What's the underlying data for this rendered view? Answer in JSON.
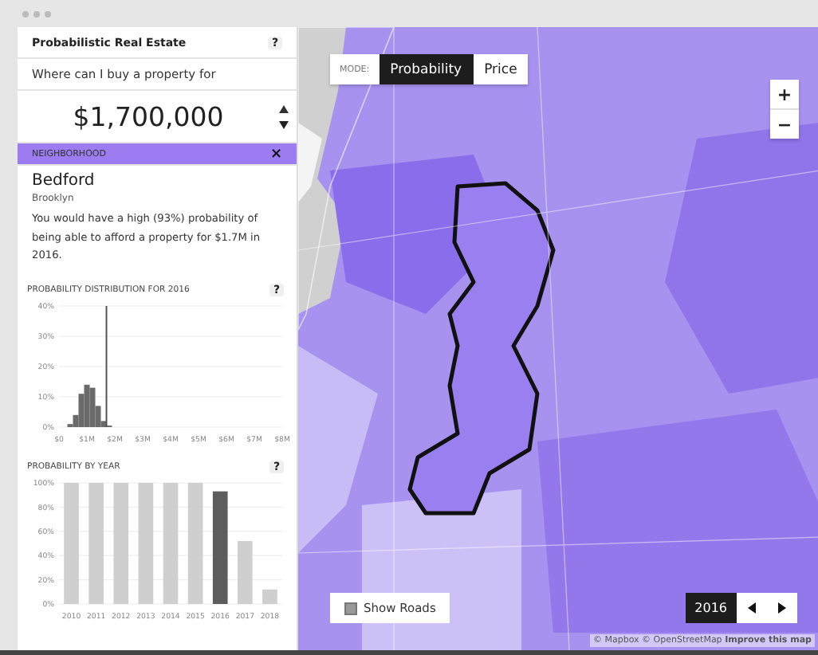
{
  "panel": {
    "title": "Probabilistic Real Estate",
    "help": "?",
    "prompt": "Where can I buy a property for",
    "price": "$1,700,000"
  },
  "neighborhood": {
    "header": "NEIGHBORHOOD",
    "close": "×",
    "name": "Bedford",
    "borough": "Brooklyn",
    "summary": "You would have a high (93%) probability of being able to afford a property for $1.7M in 2016."
  },
  "charts": [
    {
      "title": "PROBABILITY DISTRIBUTION FOR 2016",
      "help": "?",
      "chart_data": {
        "type": "bar",
        "x": [
          0.4,
          0.6,
          0.8,
          1.0,
          1.2,
          1.4,
          1.6,
          1.8
        ],
        "values": [
          1,
          4,
          11,
          14,
          13,
          7,
          2,
          0.5
        ],
        "grid": true,
        "xlim": [
          0,
          8
        ],
        "ylim": [
          0,
          40
        ],
        "xticks": [
          {
            "value": 0,
            "label": "$0"
          },
          {
            "value": 1,
            "label": "$1M"
          },
          {
            "value": 2,
            "label": "$2M"
          },
          {
            "value": 3,
            "label": "$3M"
          },
          {
            "value": 4,
            "label": "$4M"
          },
          {
            "value": 5,
            "label": "$5M"
          },
          {
            "value": 6,
            "label": "$6M"
          },
          {
            "value": 7,
            "label": "$7M"
          },
          {
            "value": 8,
            "label": "$8M"
          }
        ],
        "yticks": [
          {
            "value": 0,
            "label": "0%"
          },
          {
            "value": 10,
            "label": "10%"
          },
          {
            "value": 20,
            "label": "20%"
          },
          {
            "value": 30,
            "label": "30%"
          },
          {
            "value": 40,
            "label": "40%"
          }
        ],
        "ref_lines": [
          {
            "axis": "x",
            "value": 1.7
          }
        ]
      }
    },
    {
      "title": "PROBABILITY BY YEAR",
      "help": "?",
      "chart_data": {
        "type": "bar",
        "categories": [
          "2010",
          "2011",
          "2012",
          "2013",
          "2014",
          "2015",
          "2016",
          "2017",
          "2018"
        ],
        "grid": true,
        "series": [
          {
            "color": "#cfcfcf",
            "values": [
              100,
              100,
              100,
              100,
              100,
              100,
              null,
              52,
              12
            ]
          },
          {
            "color": "#5d5d5d",
            "values": [
              null,
              null,
              null,
              null,
              null,
              null,
              93,
              null,
              null
            ]
          }
        ],
        "ylim": [
          0,
          100
        ],
        "yticks": [
          {
            "value": 0,
            "label": "0%"
          },
          {
            "value": 20,
            "label": "20%"
          },
          {
            "value": 40,
            "label": "40%"
          },
          {
            "value": 60,
            "label": "60%"
          },
          {
            "value": 80,
            "label": "80%"
          },
          {
            "value": 100,
            "label": "100%"
          }
        ]
      }
    }
  ],
  "map": {
    "mode_label": "MODE:",
    "modes": [
      {
        "label": "Probability",
        "selected": true
      },
      {
        "label": "Price",
        "selected": false
      }
    ],
    "zoom": [
      "+",
      "−"
    ],
    "show_roads": {
      "label": "Show Roads",
      "checked": true
    },
    "year": "2016",
    "attribution": "© Mapbox © OpenStreetMap **Improve this map**"
  }
}
